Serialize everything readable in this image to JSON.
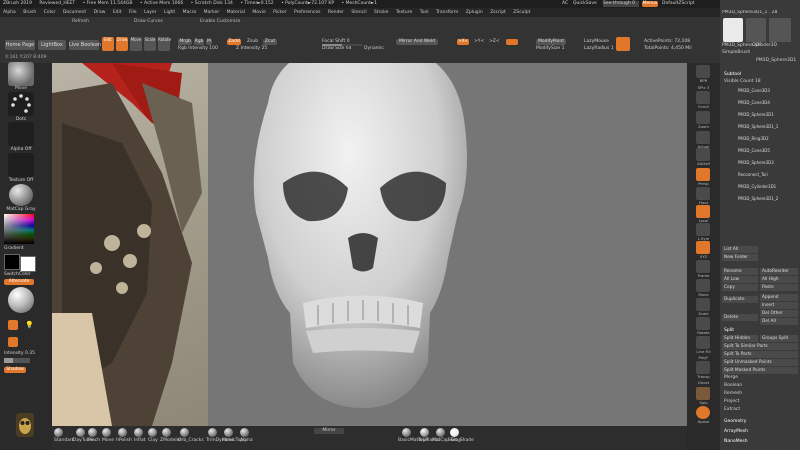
{
  "titlebar": {
    "app": "ZBrush 2019",
    "doc": "Reviewed_HEET",
    "free_mem": "• Free Mem 11.544GB",
    "active_mem": "• Active Mem 1066",
    "scratch": "• Scratch Disk 134",
    "timer": "• Timer►0.152",
    "polycount": "• PolyCount►72.107 KP",
    "meshcount": "• MeshCount►1",
    "ac": "AC",
    "quicksave": "QuickSave",
    "seethrough": "See-through 0",
    "menus": "Menus",
    "script": "DefaultZScript"
  },
  "menubar": {
    "items": [
      "Alpha",
      "Brush",
      "Color",
      "Document",
      "Draw",
      "Edit",
      "File",
      "Layer",
      "Light",
      "Macro",
      "Marker",
      "Material",
      "Movie",
      "Picker",
      "Preferences",
      "Render",
      "Stencil",
      "Stroke",
      "Texture",
      "Tool",
      "Transform",
      "Zplugin",
      "Zscript",
      "ZSculpt"
    ]
  },
  "toolbar": {
    "home_page": "Home Page",
    "lightbox": "LightBox",
    "live_boolean": "Live Boolean",
    "edit": "Edit",
    "draw": "Draw",
    "move": "Move",
    "scale": "Scale",
    "rotate": "Rotate",
    "mrgb": "Mrgb",
    "rgb": "Rgb",
    "m": "M",
    "zadd": "Zadd",
    "zsub": "Zsub",
    "zcut": "Zcut",
    "rgb_intensity": "Rgb Intensity 100",
    "z_intensity": "Z Intensity 25",
    "focal_shift": "Focal Shift 0",
    "draw_size": "Draw Size 64",
    "dynamic": "Dynamic",
    "mirror_and_weld": "Mirror And Weld",
    "x": ">X<",
    "y": ">Y<",
    "z": ">Z<",
    "modify_point": "ModifyPoint",
    "modify_size": "ModifySize 1",
    "lazymouse": "LazyMouse",
    "lazy_radius": "LazyRadius 1",
    "active_points": "ActivePoints: 72,108",
    "total_points": "TotalPoints: 4,450 Mil",
    "refresh": "Refresh",
    "draw_curves": "Draw Curves",
    "enable_customize": "Enable Customize"
  },
  "leftshelf": {
    "brush_label": "Move",
    "stroke_label": "Dots",
    "alpha_label": "Alpha Off",
    "texture_label": "Texture Off",
    "material_label": "MatCap Gray",
    "gradient_label": "Gradient",
    "switch_color": "SwitchColor",
    "alternate": "Alternate",
    "intensity": "Intensity 0.35",
    "shadow": "Shadow",
    "coords": "X:161 Y:207 B:409"
  },
  "bottomshelf": {
    "brushes": [
      "Standard",
      "ClayTubes",
      "Pinch",
      "Move",
      "hPolish",
      "Inflat",
      "Clay",
      "ZModeler",
      "Orb_Cracks",
      "TrimDynamic",
      "Move Topo",
      "Alpha"
    ],
    "brushes_right": [
      "BasicMaterial",
      "ToyPlastic",
      "MatCap Gray",
      "Skin_Shade"
    ],
    "mirror": "Mirror"
  },
  "rightshelf": {
    "items": [
      "BPR",
      "SPix 3",
      "Scroll",
      "Zoom",
      "Actual",
      "AAHalf",
      "Persp",
      "Floor",
      "Local",
      "L.Sym",
      "XYZ",
      "Frame",
      "Move",
      "Scale",
      "Rotate",
      "Line Fill",
      "PolyF",
      "Transp",
      "Ghost",
      "Solo",
      "Xpose"
    ]
  },
  "tray": {
    "tool_name": "PM3D_Sphere3D1_1 . 28",
    "tool_thumbs": [
      "PM3D_Sphere3D1",
      "Cylinder3D",
      "SimpleBrush",
      "PM3D_Sphere3D1",
      "PolyMesh3D",
      "PM3D_Sphere3D1"
    ],
    "subtool_header": "Subtool",
    "visible_count": "Visible Count 18",
    "subtools": [
      "PM3D_Cone3D3",
      "PM3D_Cone3D4",
      "PM3D_Sphere3D1",
      "PM3D_Sphere3D1_1",
      "PM3D_Ring3D2",
      "PM3D_Cone3D5",
      "PM3D_Sphere3D3",
      "Reconnect_Tori",
      "PM3D_Cylinder3D1",
      "PM3D_Sphere3D1_2"
    ],
    "list_all": "List All",
    "new_folder": "New Folder",
    "rename": "Rename",
    "auto_reorder": "AutoReorder",
    "all_low": "All Low",
    "all_high": "All High",
    "copy": "Copy",
    "paste": "Paste",
    "duplicate": "Duplicate",
    "append": "Append",
    "insert": "Insert",
    "delete": "Delete",
    "del_other": "Del Other",
    "del_all": "Del All",
    "split_header": "Split",
    "split_hidden": "Split Hidden",
    "groups_split": "Groups Split",
    "split_similar": "Split To Similar Parts",
    "split_parts": "Split To Parts",
    "split_unmasked": "Split Unmasked Points",
    "split_masked": "Split Masked Points",
    "merge": "Merge",
    "boolean": "Boolean",
    "remesh": "Remesh",
    "project": "Project",
    "extract": "Extract",
    "geometry": "Geometry",
    "arraymesh": "ArrayMesh",
    "nanomesh": "NanoMesh"
  },
  "colors": {
    "accent": "#e0772a",
    "canvas_bg": "#767676",
    "ui_bg": "#2b2b2b"
  }
}
